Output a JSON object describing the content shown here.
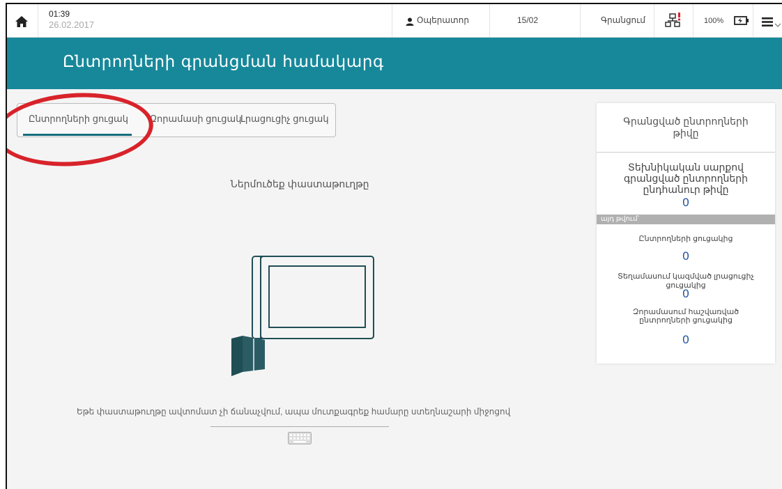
{
  "topbar": {
    "time": "01:39",
    "date": "26.02.2017",
    "operator": "Օպերատոր",
    "counter": "15/02",
    "status": "Գրանցում",
    "battery": "100%"
  },
  "header": {
    "title": "Ընտրողների գրանցման համակարգ"
  },
  "tabs": [
    {
      "label": "Ընտրողների ցուցակ",
      "active": true
    },
    {
      "label": "Զորամասի ցուցակ",
      "active": false
    },
    {
      "label": "Լրացուցիչ ցուցակ",
      "active": false
    }
  ],
  "main": {
    "prompt": "Ներմուծեք փաստաթուղթը",
    "hint": "Եթե փաստաթուղթը ավտոմատ չի ճանաչվում, ապա մուտքագրեք համարը ստեղնաշարի միջոցով"
  },
  "card": {
    "title": "Գրանցված ընտրողների թիվը",
    "total_label": "Տեխնիկական սարքով գրանցված ընտրողների ընդհանուր թիվը",
    "total_value": "0",
    "band": "այդ թվում՝",
    "items": [
      {
        "label": "Ընտրողների ցուցակից",
        "value": "0"
      },
      {
        "label": "Տեղամասում կազմված լրացուցիչ ցուցակից",
        "value": "0"
      },
      {
        "label": "Զորամասում հաշվառված ընտրողների ցուցակից",
        "value": "0"
      }
    ]
  },
  "icons": {
    "home": "home-icon",
    "user": "user-icon",
    "network": "network-icon",
    "battery": "battery-charging-icon",
    "menu": "hamburger-menu-icon",
    "chevron": "chevron-down-icon",
    "keyboard": "keyboard-icon",
    "device": "document-scanner-icon"
  },
  "colors": {
    "header": "#17889a",
    "tab_active": "#146d7d",
    "value": "#1d4f9c",
    "alert": "#d8232a"
  }
}
